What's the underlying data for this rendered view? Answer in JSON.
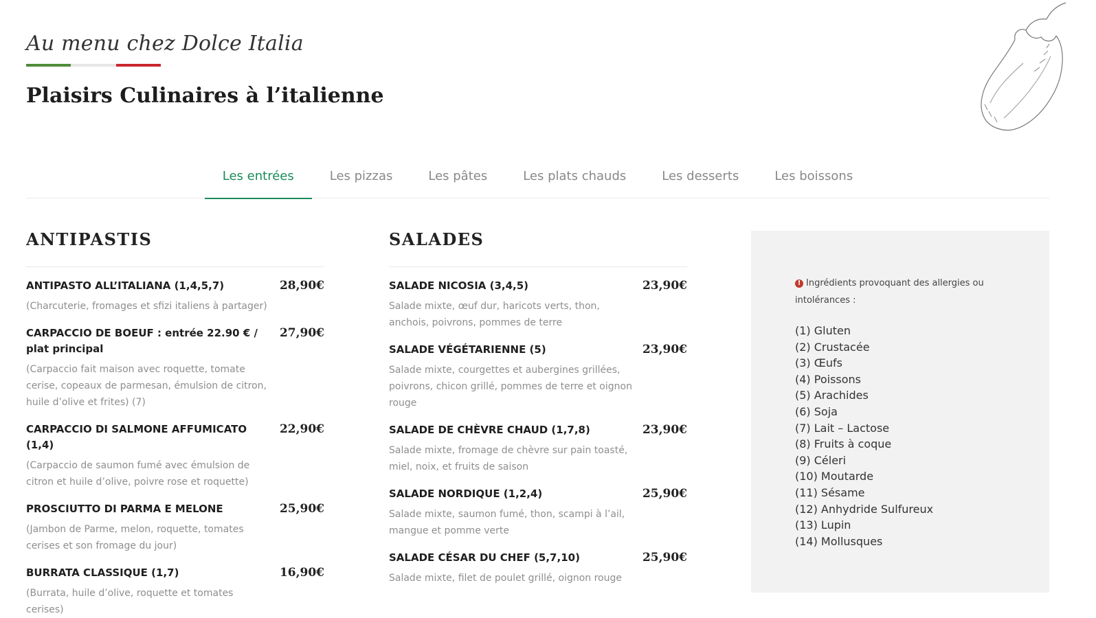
{
  "header": {
    "script_title": "Au menu chez Dolce Italia",
    "flag_colors": [
      "#4f8a3a",
      "#e6e6e6",
      "#c8272d"
    ],
    "main_title": "Plaisirs Culinaires à l’italienne",
    "decor_icon": "eggplant-sketch-icon"
  },
  "tabs": [
    {
      "label": "Les entrées",
      "active": true
    },
    {
      "label": "Les pizzas",
      "active": false
    },
    {
      "label": "Les pâtes",
      "active": false
    },
    {
      "label": "Les plats chauds",
      "active": false
    },
    {
      "label": "Les desserts",
      "active": false
    },
    {
      "label": "Les boissons",
      "active": false
    }
  ],
  "antipastis": {
    "title": "ANTIPASTIS",
    "items": [
      {
        "name": "ANTIPASTO ALL’ITALIANA (1,4,5,7)",
        "price": "28,90€",
        "desc": "(Charcuterie, fromages et sfizi italiens à partager)"
      },
      {
        "name": "CARPACCIO DE BOEUF : entrée 22.90 € / plat principal",
        "price": "27,90€",
        "desc": "(Carpaccio fait maison avec roquette, tomate cerise, copeaux de parmesan, émulsion de citron, huile d’olive et frites) (7)"
      },
      {
        "name": "CARPACCIO DI SALMONE AFFUMICATO (1,4)",
        "price": "22,90€",
        "desc": "(Carpaccio de saumon fumé avec émulsion de citron et huile d’olive, poivre rose et roquette)"
      },
      {
        "name": "PROSCIUTTO DI PARMA E MELONE",
        "price": "25,90€",
        "desc": "(Jambon de Parme, melon, roquette, tomates cerises et son fromage du jour)"
      },
      {
        "name": "BURRATA CLASSIQUE (1,7)",
        "price": "16,90€",
        "desc": "(Burrata, huile d’olive, roquette et tomates cerises)"
      }
    ]
  },
  "salades": {
    "title": "SALADES",
    "items": [
      {
        "name": "SALADE NICOSIA (3,4,5)",
        "price": "23,90€",
        "desc": "Salade mixte, œuf dur, haricots verts, thon, anchois, poivrons, pommes de terre"
      },
      {
        "name": "SALADE VÉGÉTARIENNE (5)",
        "price": "23,90€",
        "desc": "Salade mixte, courgettes et aubergines grillées, poivrons, chicon grillé, pommes de terre et oignon rouge"
      },
      {
        "name": "SALADE DE CHÈVRE CHAUD (1,7,8)",
        "price": "23,90€",
        "desc": "Salade mixte, fromage de chèvre sur pain toasté, miel, noix, et fruits de saison"
      },
      {
        "name": "SALADE NORDIQUE (1,2,4)",
        "price": "25,90€",
        "desc": "Salade mixte, saumon fumé, thon, scampi à l’ail, mangue et pomme verte"
      },
      {
        "name": "SALADE CÉSAR DU CHEF (5,7,10)",
        "price": "25,90€",
        "desc": "Salade mixte, filet de poulet grillé, oignon rouge"
      }
    ]
  },
  "allergy": {
    "note": "Ingrédients provoquant des allergies ou intolérances :",
    "list": [
      "(1) Gluten",
      "(2) Crustacée",
      "(3) Œufs",
      "(4) Poissons",
      "(5) Arachides",
      "(6) Soja",
      "(7) Lait – Lactose",
      "(8) Fruits à coque",
      "(9) Céleri",
      "(10) Moutarde",
      "(11) Sésame",
      "(12) Anhydride Sulfureux",
      "(13) Lupin",
      "(14) Mollusques"
    ]
  }
}
